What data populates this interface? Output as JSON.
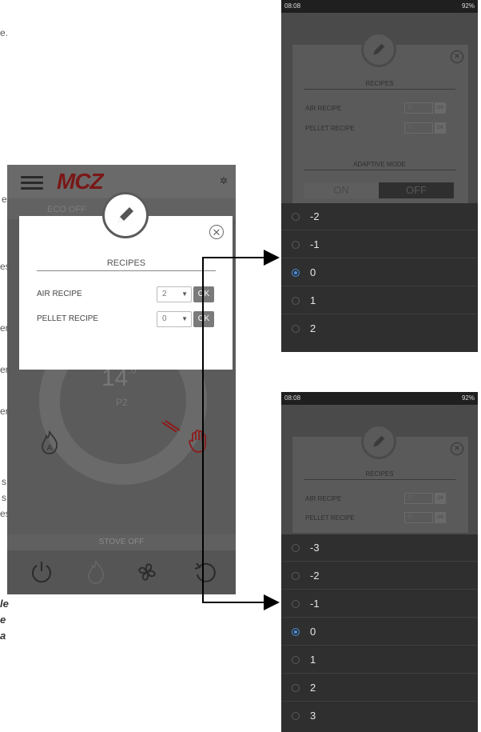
{
  "page_fragments": [
    "e.",
    "e",
    "es",
    "er",
    "er",
    "er",
    "s",
    "s",
    "es",
    "le",
    "e",
    "a"
  ],
  "app": {
    "logo": "MCZ",
    "strip_text": "ECO OFF",
    "temperature": "14",
    "temperature_unit": ".0",
    "power_level": "P2",
    "status": "STOVE OFF"
  },
  "dialog": {
    "section_title": "RECIPES",
    "rows": [
      {
        "label": "AIR RECIPE",
        "value": "2",
        "ok": "OK"
      },
      {
        "label": "PELLET RECIPE",
        "value": "0",
        "ok": "OK"
      }
    ]
  },
  "phone_top": {
    "status_time": "08:08",
    "status_right": "92%",
    "section_title": "RECIPES",
    "rows": [
      {
        "label": "AIR RECIPE",
        "value": "0",
        "ok": "OK"
      },
      {
        "label": "PELLET RECIPE",
        "value": "0",
        "ok": "OK"
      }
    ],
    "adaptive_title": "ADAPTIVE MODE",
    "toggle_on": "ON",
    "toggle_off": "OFF",
    "options": [
      "-2",
      "-1",
      "0",
      "1",
      "2"
    ],
    "selected": "0"
  },
  "phone_bottom": {
    "status_time": "08:08",
    "status_right": "92%",
    "section_title": "RECIPES",
    "rows": [
      {
        "label": "AIR RECIPE",
        "value": "0",
        "ok": "OK"
      },
      {
        "label": "PELLET RECIPE",
        "value": "0",
        "ok": "OK"
      }
    ],
    "options": [
      "-3",
      "-2",
      "-1",
      "0",
      "1",
      "2",
      "3"
    ],
    "selected": "0"
  }
}
